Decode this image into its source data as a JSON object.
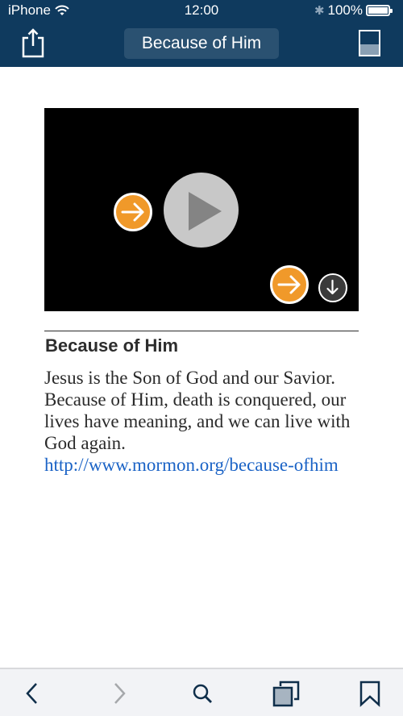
{
  "status_bar": {
    "carrier": "iPhone",
    "time": "12:00",
    "battery_percent": "100%",
    "bluetooth_icon": "bluetooth-icon",
    "wifi_icon": "wifi-icon",
    "battery_icon": "battery-icon"
  },
  "navbar": {
    "title": "Because of Him",
    "share_icon": "share-icon",
    "panel_icon": "panel-toggle-icon"
  },
  "video": {
    "play_icon": "play-icon",
    "link_icon": "arrow-right-circle-icon",
    "download_icon": "download-icon"
  },
  "article": {
    "heading": "Because of Him",
    "body": "Jesus is the Son of God and our Savior. Because of Him, death is conquered, our lives have meaning, and we can live with God again.",
    "link_text": "http://www.mormon.org/because-ofhim"
  },
  "toolbar": {
    "items": [
      {
        "icon": "back-icon",
        "enabled": true
      },
      {
        "icon": "forward-icon",
        "enabled": false
      },
      {
        "icon": "search-icon",
        "enabled": true
      },
      {
        "icon": "copy-icon",
        "enabled": true
      },
      {
        "icon": "bookmark-icon",
        "enabled": true
      }
    ]
  },
  "colors": {
    "header_bg": "#0f3a5e",
    "accent_orange": "#f0992a",
    "link_blue": "#1b63c6",
    "toolbar_icon": "#0f2e4a"
  }
}
